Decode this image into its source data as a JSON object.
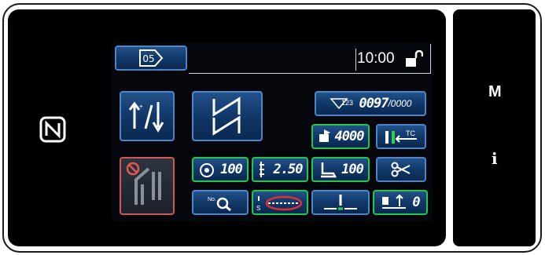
{
  "header": {
    "pattern_no": "05",
    "time": "10:00"
  },
  "counter": {
    "value": "0097",
    "target": "/0000"
  },
  "speed": {
    "value": "4000"
  },
  "thread_tension": {
    "value": "100"
  },
  "stitch_length": {
    "value": "2.50"
  },
  "presser_pressure": {
    "value": "100"
  },
  "feed_compensation": {
    "value": "0"
  },
  "thread_trim": {
    "tc_label": "TC"
  },
  "side_keys": {
    "menu": "M",
    "info": "i"
  },
  "colors": {
    "panel": "#000000",
    "button_blue": "#1b4a80",
    "green_frame": "#22c84a",
    "red_frame": "#d05a52"
  }
}
